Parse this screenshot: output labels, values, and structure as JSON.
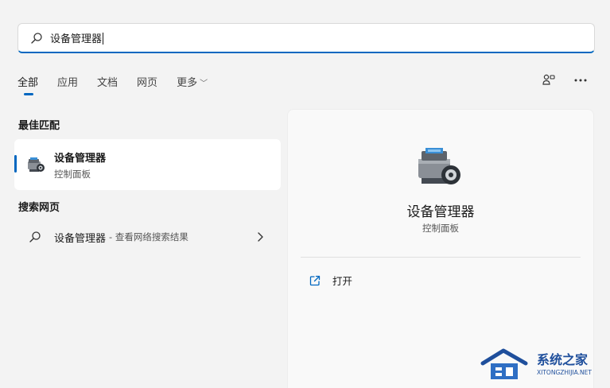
{
  "search": {
    "query": "设备管理器"
  },
  "tabs": [
    {
      "label": "全部",
      "active": true
    },
    {
      "label": "应用"
    },
    {
      "label": "文档"
    },
    {
      "label": "网页"
    },
    {
      "label": "更多"
    }
  ],
  "icons": {
    "search": "search-icon",
    "connect": "share-connect-icon",
    "more": "more-dots-icon",
    "app": "device-manager-icon",
    "arrow": "chevron-right-icon",
    "open": "open-external-icon"
  },
  "best_match": {
    "heading": "最佳匹配",
    "name": "设备管理器",
    "subtitle": "控制面板"
  },
  "web_search": {
    "heading": "搜索网页",
    "term": "设备管理器",
    "suffix": "- 查看网络搜索结果"
  },
  "detail": {
    "title": "设备管理器",
    "subtitle": "控制面板",
    "actions": [
      {
        "label": "打开"
      }
    ]
  },
  "watermark": {
    "brand": "系统之家",
    "url": "XITONGZHIJIA.NET"
  },
  "colors": {
    "accent": "#0067c0",
    "background": "#f3f3f3"
  }
}
